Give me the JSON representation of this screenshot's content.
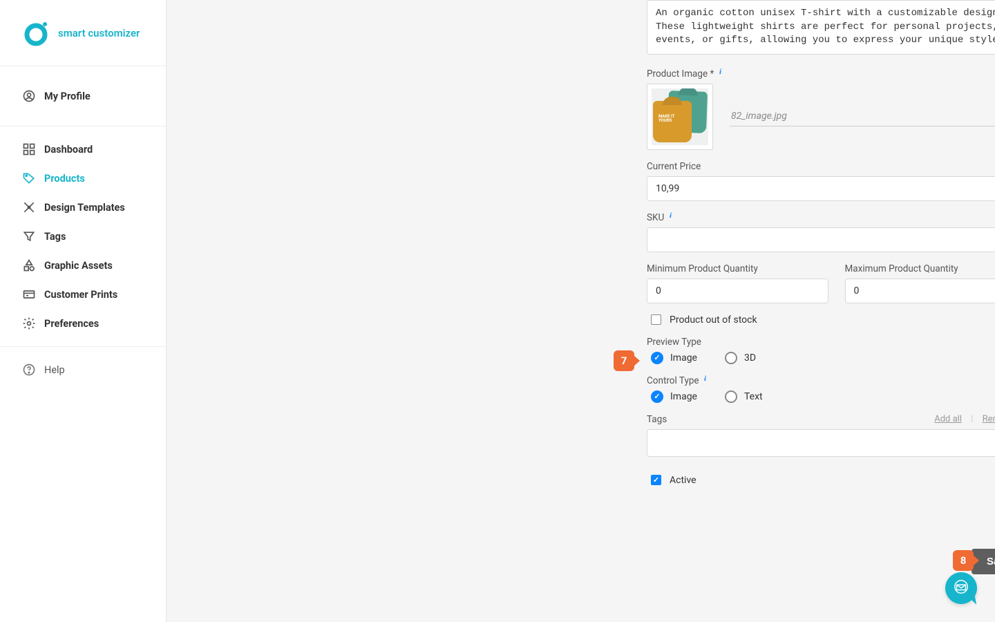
{
  "brand": {
    "name": "smart customizer"
  },
  "sidebar": {
    "profile": "My Profile",
    "items": [
      {
        "label": "Dashboard"
      },
      {
        "label": "Products"
      },
      {
        "label": "Design Templates"
      },
      {
        "label": "Tags"
      },
      {
        "label": "Graphic Assets"
      },
      {
        "label": "Customer Prints"
      },
      {
        "label": "Preferences"
      }
    ],
    "help": "Help"
  },
  "form": {
    "description": {
      "value": "An organic cotton unisex T-shirt with a customizable design. These lightweight shirts are perfect for personal projects, events, or gifts, allowing you to express your unique style!"
    },
    "productImage": {
      "label": "Product Image *",
      "filename": "82_image.jpg",
      "thumbPrint": "MAKE IT YOURS"
    },
    "currentPrice": {
      "label": "Current Price",
      "value": "10,99"
    },
    "sku": {
      "label": "SKU",
      "value": ""
    },
    "minQty": {
      "label": "Minimum Product Quantity",
      "value": "0"
    },
    "maxQty": {
      "label": "Maximum Product Quantity",
      "value": "0"
    },
    "outOfStock": {
      "label": "Product out of stock",
      "checked": false
    },
    "previewType": {
      "label": "Preview Type",
      "options": [
        "Image",
        "3D"
      ],
      "selected": "Image"
    },
    "controlType": {
      "label": "Control Type",
      "options": [
        "Image",
        "Text"
      ],
      "selected": "Image"
    },
    "tags": {
      "label": "Tags",
      "addAll": "Add all",
      "removeAll": "Remove all"
    },
    "active": {
      "label": "Active",
      "checked": true
    },
    "saveLabel": "Save"
  },
  "callouts": {
    "seven": "7",
    "eight": "8"
  }
}
